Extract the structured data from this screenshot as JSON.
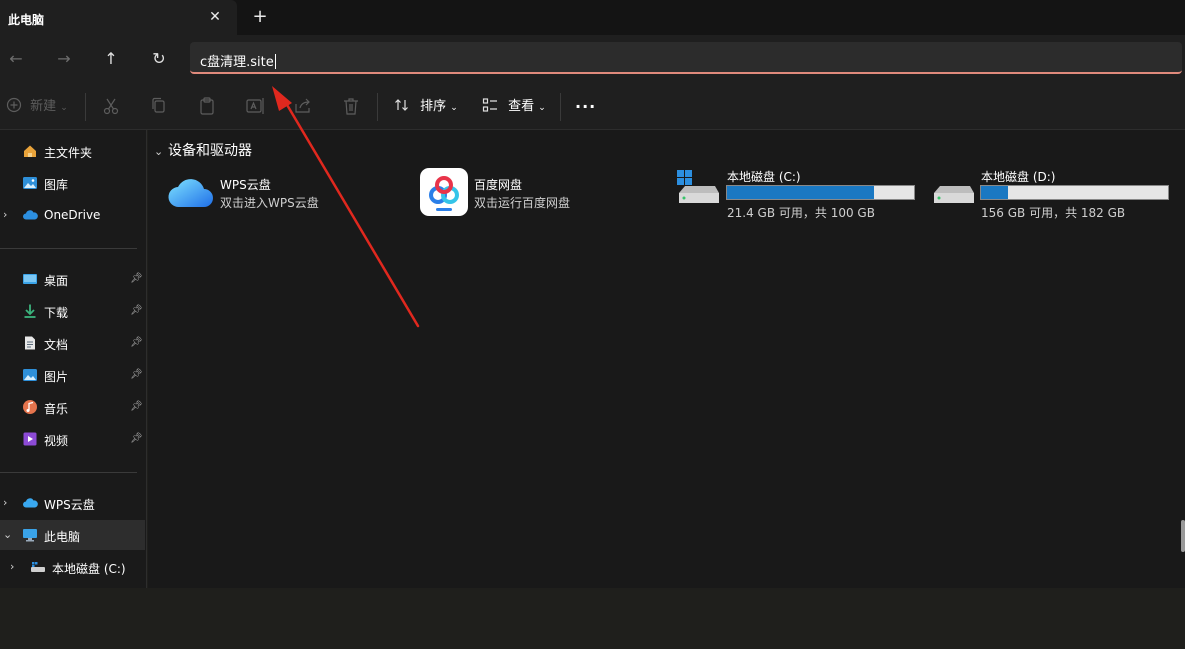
{
  "tab": {
    "title": "此电脑",
    "close": "✕",
    "new_tab": "+"
  },
  "nav": {
    "back": "←",
    "forward": "→",
    "up": "↑",
    "refresh": "↻",
    "address_value": "c盘清理.site"
  },
  "toolbar": {
    "new_label": "新建",
    "sort_label": "排序",
    "view_label": "查看",
    "more": "···"
  },
  "sidebar": {
    "home": "主文件夹",
    "gallery": "图库",
    "onedrive": "OneDrive",
    "pinned": [
      {
        "label": "桌面"
      },
      {
        "label": "下载"
      },
      {
        "label": "文档"
      },
      {
        "label": "图片"
      },
      {
        "label": "音乐"
      },
      {
        "label": "视频"
      }
    ],
    "wps": "WPS云盘",
    "this_pc": "此电脑",
    "local_c": "本地磁盘 (C:)"
  },
  "content": {
    "section_title": "设备和驱动器",
    "wps": {
      "name": "WPS云盘",
      "sub": "双击进入WPS云盘"
    },
    "baidu": {
      "name": "百度网盘",
      "sub": "双击运行百度网盘"
    },
    "drive_c": {
      "name": "本地磁盘 (C:)",
      "info": "21.4 GB 可用，共 100 GB",
      "used_fraction": 0.786
    },
    "drive_d": {
      "name": "本地磁盘 (D:)",
      "info": "156 GB 可用，共 182 GB",
      "used_fraction": 0.143
    }
  },
  "colors": {
    "accent": "#1a78c2",
    "annotation_arrow": "#e0281e",
    "address_underline": "#e08a7c"
  }
}
